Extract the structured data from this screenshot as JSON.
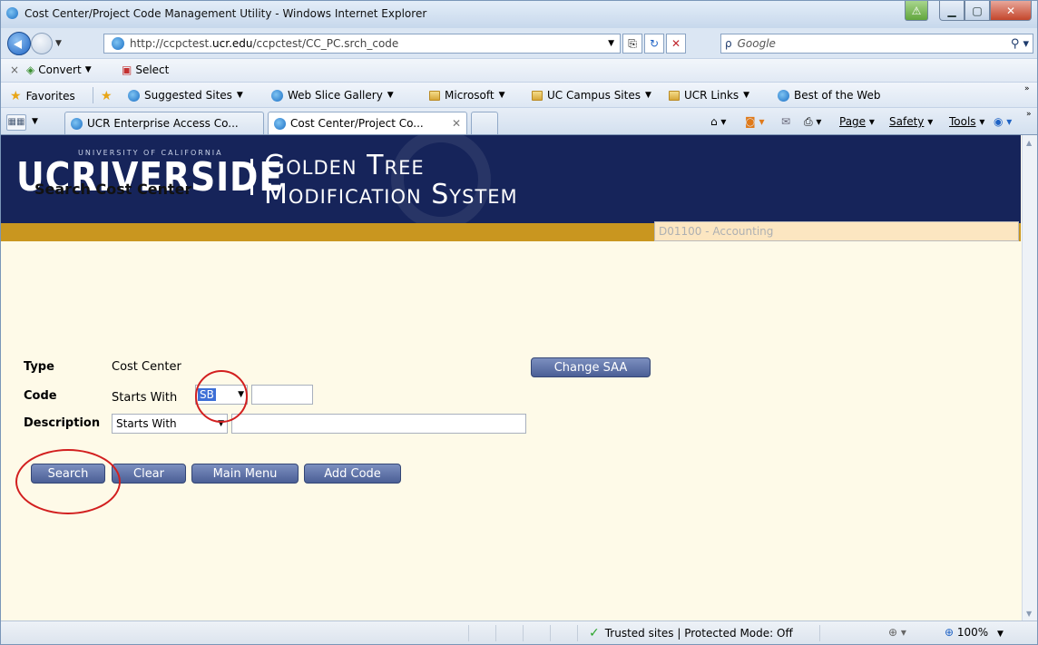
{
  "window": {
    "title": "Cost Center/Project Code Management Utility - Windows Internet Explorer"
  },
  "address": {
    "url_prefix": "http://ccpctest.",
    "url_domain": "ucr.edu",
    "url_suffix": "/ccpctest/CC_PC.srch_code",
    "search_placeholder": "Google"
  },
  "command_bar": {
    "convert_label": "Convert",
    "select_label": "Select"
  },
  "favorites_bar": {
    "favorites_label": "Favorites",
    "items": [
      {
        "label": "Suggested Sites",
        "icon": "ie-icon",
        "dropdown": true
      },
      {
        "label": "Web Slice Gallery",
        "icon": "ie-icon",
        "dropdown": true
      },
      {
        "label": "Microsoft",
        "icon": "folder-icon",
        "dropdown": true
      },
      {
        "label": "UC Campus Sites",
        "icon": "folder-icon",
        "dropdown": true
      },
      {
        "label": "UCR Links",
        "icon": "folder-icon",
        "dropdown": true
      },
      {
        "label": "Best of the Web",
        "icon": "ie-icon",
        "dropdown": false
      }
    ]
  },
  "tabs": [
    {
      "label": "UCR Enterprise Access Co..."
    },
    {
      "label": "Cost Center/Project Co..."
    }
  ],
  "toolbar_right": {
    "page": "Page",
    "safety": "Safety",
    "tools": "Tools"
  },
  "banner": {
    "logo_main": "UCRIVERSIDE",
    "logo_small": "UNIVERSITY OF CALIFORNIA",
    "system_line1": "Golden Tree",
    "system_line2": "Modification System"
  },
  "form": {
    "heading": "Search Cost Center",
    "type_label": "Type",
    "type_value": "Cost Center",
    "code_label": "Code",
    "code_prefix": "Starts With",
    "code_select_value": "SB",
    "description_label": "Description",
    "description_select_value": "Starts With",
    "change_saa_label": "Change SAA",
    "saa_value": "D01100 - Accounting"
  },
  "buttons": {
    "search": "Search",
    "clear": "Clear",
    "main_menu": "Main Menu",
    "add_code": "Add Code"
  },
  "status_bar": {
    "zone": "Trusted sites | Protected Mode: Off",
    "zoom": "100%"
  },
  "colors": {
    "banner_navy": "#16245a",
    "banner_gold": "#c9961f",
    "page_background": "#fefae8",
    "button_blue": "#4b5f96",
    "annotation_red": "#d21f1f"
  }
}
